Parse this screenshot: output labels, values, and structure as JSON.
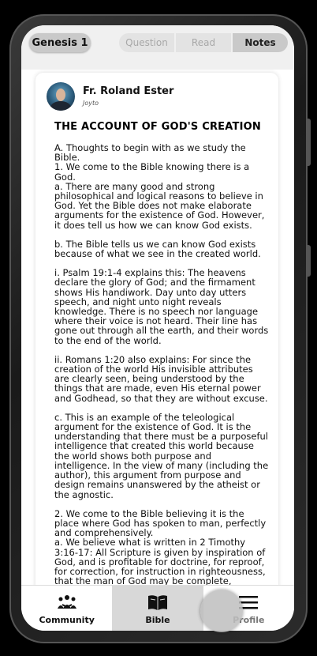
{
  "header": {
    "book": "Genesis 1",
    "tabs": [
      "Question",
      "Read",
      "Notes"
    ],
    "active_tab": "Notes"
  },
  "note": {
    "author": "Fr. Roland Ester",
    "author_sub": "Joyto",
    "title": "THE ACCOUNT OF GOD'S CREATION",
    "paragraphs": [
      "A. Thoughts to begin with as we study the Bible.\n1. We come to the Bible knowing there is a God.\na. There are many good and strong philosophical and logical reasons to believe in God. Yet the Bible does not make elaborate arguments for the existence of God. However, it does tell us how we can know God exists.",
      "b. The Bible tells us we can know God exists because of what we see in the created world.",
      "i. Psalm 19:1-4 explains this: The heavens declare the glory of God; and the firmament shows His handiwork. Day unto day utters speech, and night unto night reveals knowledge. There is no speech nor language where their voice is not heard. Their line has gone out through all the earth, and their words to the end of the world.",
      "ii. Romans 1:20 also explains: For since the creation of the world His invisible attributes are clearly seen, being understood by the things that are made, even His eternal power and Godhead, so that they are without excuse.",
      "c. This is an example of the teleological argument for the existence of God. It is the understanding that there must be a purposeful intelligence that created this world because the world shows both purpose and intelligence. In the view of many (including the author), this argument from purpose and design remains unanswered by the atheist or the agnostic.",
      "2. We come to the Bible believing it is the place where God has spoken to man, perfectly and comprehensively.\na. We believe what is written in 2 Timothy 3:16-17: All Scripture is given by inspiration of God, and is profitable for doctrine, for reproof, for correction, for instruction in righteousness, that the man of God may be complete,"
    ]
  },
  "bottom_nav": {
    "items": [
      {
        "label": "Community",
        "icon": "community-icon"
      },
      {
        "label": "Bible",
        "icon": "book-icon"
      },
      {
        "label": "Profile",
        "icon": "menu-icon"
      }
    ],
    "active": "Bible"
  }
}
